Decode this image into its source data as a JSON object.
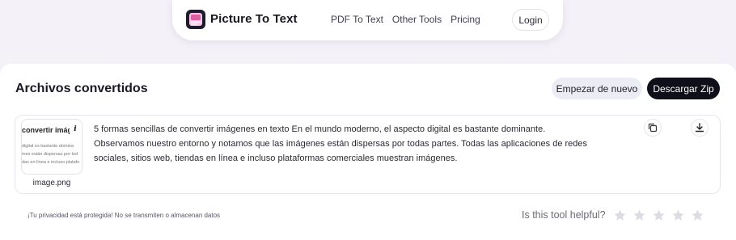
{
  "nav": {
    "brand": "Picture To Text",
    "links": [
      "PDF To Text",
      "Other Tools",
      "Pricing"
    ],
    "login_label": "Login"
  },
  "main": {
    "title": "Archivos convertidos",
    "restart_label": "Empezar de nuevo",
    "download_zip_label": "Descargar Zip"
  },
  "result": {
    "thumbnail": {
      "heading": "convertir imágen",
      "lines": [
        "digital es bastante domina",
        "mes están dispersas por tod",
        "das en línea e incluso platafo"
      ],
      "info_label": "i",
      "filename": "image.png"
    },
    "text": " 5 formas sencillas de convertir imágenes en texto En el mundo moderno, el aspecto digital es bastante dominante. Observamos nuestro entorno y notamos que las imágenes están dispersas por todas partes. Todas las aplicaciones de redes sociales, sitios web, tiendas en línea e incluso plataformas comerciales muestran imágenes."
  },
  "footer": {
    "privacy": "¡Tu privacidad está protegida! No se transmiten o almacenan datos",
    "helpful_label": "Is this tool helpful?",
    "rating_max": 5,
    "rating_value": 0
  },
  "colors": {
    "accent_dark": "#0f0f1a",
    "logo_accent": "#e05fa4",
    "star_empty": "#dcdce3"
  }
}
